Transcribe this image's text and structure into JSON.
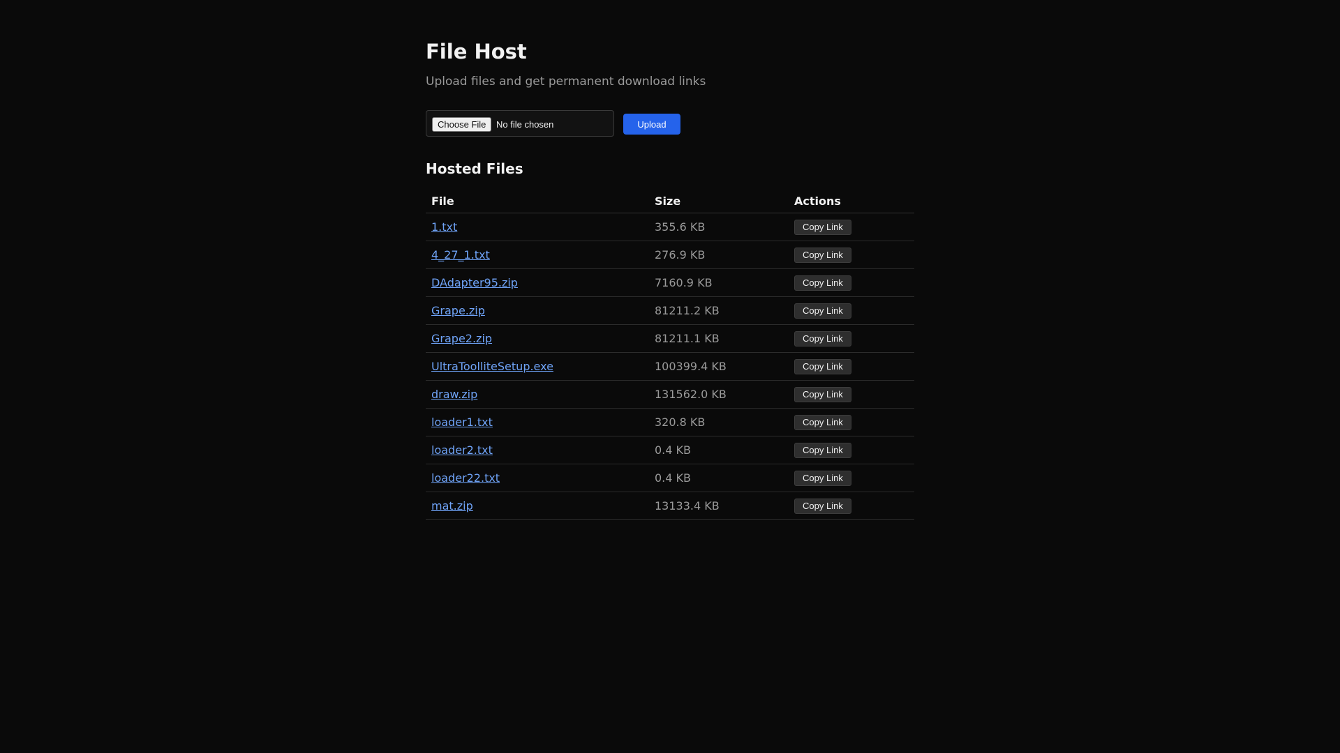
{
  "header": {
    "title": "File Host",
    "subtitle": "Upload files and get permanent download links"
  },
  "upload": {
    "choose_label": "Choose File",
    "no_file_text": "No file chosen",
    "upload_label": "Upload"
  },
  "files_section": {
    "heading": "Hosted Files",
    "columns": [
      "File",
      "Size",
      "Actions"
    ],
    "action_label": "Copy Link",
    "rows": [
      {
        "name": "1.txt",
        "size": "355.6 KB"
      },
      {
        "name": "4_27_1.txt",
        "size": "276.9 KB"
      },
      {
        "name": "DAdapter95.zip",
        "size": "7160.9 KB"
      },
      {
        "name": "Grape.zip",
        "size": "81211.2 KB"
      },
      {
        "name": "Grape2.zip",
        "size": "81211.1 KB"
      },
      {
        "name": "UltraToolliteSetup.exe",
        "size": "100399.4 KB"
      },
      {
        "name": "draw.zip",
        "size": "131562.0 KB"
      },
      {
        "name": "loader1.txt",
        "size": "320.8 KB"
      },
      {
        "name": "loader2.txt",
        "size": "0.4 KB"
      },
      {
        "name": "loader22.txt",
        "size": "0.4 KB"
      },
      {
        "name": "mat.zip",
        "size": "13133.4 KB"
      }
    ]
  },
  "colors": {
    "background": "#0a0a0a",
    "accent": "#2563eb",
    "link": "#6fa3f7"
  }
}
